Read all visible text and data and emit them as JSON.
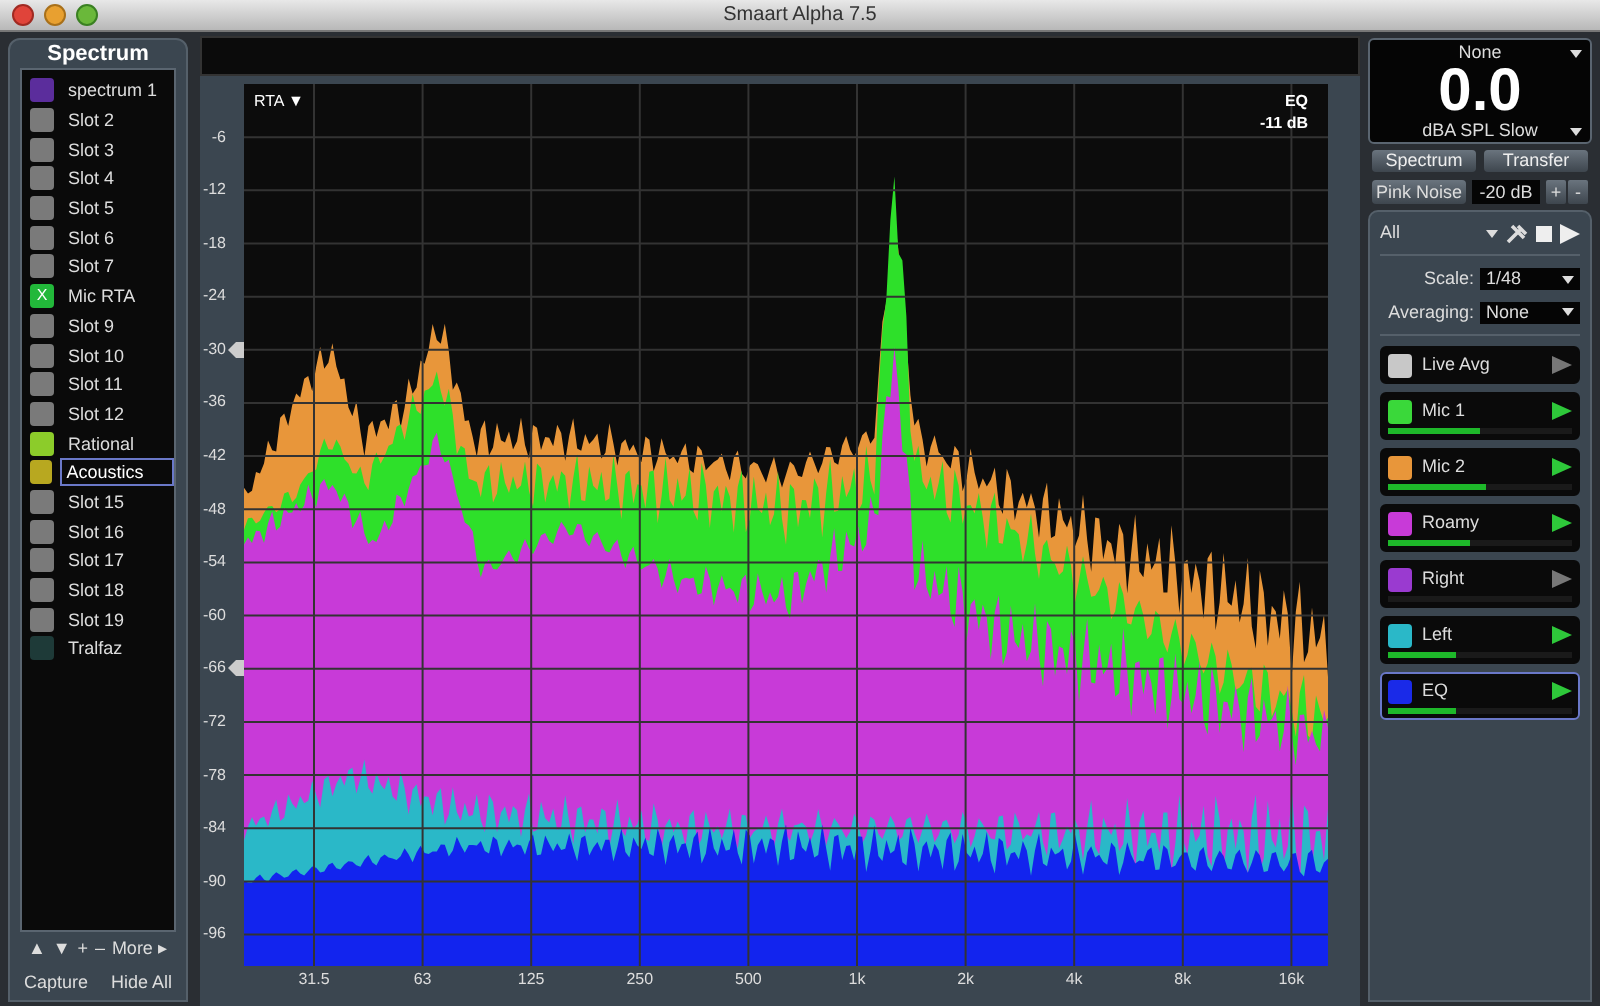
{
  "window": {
    "title": "Smaart Alpha 7.5"
  },
  "sidebar": {
    "title": "Spectrum",
    "slots": [
      {
        "name": "spectrum 1",
        "color": "#5b2d9c",
        "selected": false
      },
      {
        "name": "Slot 2",
        "color": "#7a7a7a",
        "selected": false
      },
      {
        "name": "Slot 3",
        "color": "#7a7a7a",
        "selected": false
      },
      {
        "name": "Slot 4",
        "color": "#7a7a7a",
        "selected": false
      },
      {
        "name": "Slot 5",
        "color": "#7a7a7a",
        "selected": false
      },
      {
        "name": "Slot 6",
        "color": "#7a7a7a",
        "selected": false
      },
      {
        "name": "Slot 7",
        "color": "#7a7a7a",
        "selected": false
      },
      {
        "name": "Mic RTA",
        "color": "#22b83a",
        "symbol": "X",
        "selected": false
      },
      {
        "name": "Slot 9",
        "color": "#7a7a7a",
        "selected": false
      },
      {
        "name": "Slot 10",
        "color": "#7a7a7a",
        "selected": false
      },
      {
        "name": "Slot 11",
        "color": "#7a7a7a",
        "selected": false
      },
      {
        "name": "Slot 12",
        "color": "#7a7a7a",
        "selected": false
      },
      {
        "name": "Rational",
        "color": "#8ccc2a",
        "selected": false
      },
      {
        "name": "Acoustics",
        "color": "#b8a820",
        "selected": true
      },
      {
        "name": "Slot 15",
        "color": "#7a7a7a",
        "selected": false
      },
      {
        "name": "Slot 16",
        "color": "#7a7a7a",
        "selected": false
      },
      {
        "name": "Slot 17",
        "color": "#7a7a7a",
        "selected": false
      },
      {
        "name": "Slot 18",
        "color": "#7a7a7a",
        "selected": false
      },
      {
        "name": "Slot 19",
        "color": "#7a7a7a",
        "selected": false
      },
      {
        "name": "Tralfaz",
        "color": "#1e3a38",
        "selected": false
      }
    ],
    "controls": [
      "▲",
      "▼",
      "+",
      "–",
      "More ▸"
    ],
    "buttons": [
      "Capture",
      "Hide All"
    ]
  },
  "chart": {
    "mode": "RTA ▼",
    "trace": "EQ",
    "trace_level": "-11 dB",
    "y_labels": [
      "-6",
      "-12",
      "-18",
      "-24",
      "-30",
      "-36",
      "-42",
      "-48",
      "-54",
      "-60",
      "-66",
      "-72",
      "-78",
      "-84",
      "-90",
      "-96"
    ],
    "x_labels": [
      "31.5",
      "63",
      "125",
      "250",
      "500",
      "1k",
      "2k",
      "4k",
      "8k",
      "16k"
    ]
  },
  "meter": {
    "source": "None",
    "value": "0.0",
    "unit": "dBA SPL Slow"
  },
  "mode_buttons": [
    "Spectrum",
    "Transfer"
  ],
  "generator": {
    "label": "Pink Noise",
    "gain": "-20 dB",
    "buttons": [
      "+",
      "-"
    ]
  },
  "group": {
    "label": "All",
    "scale_label": "Scale:",
    "scale": "1/48",
    "averaging_label": "Averaging:",
    "averaging": "None"
  },
  "measurements": [
    {
      "name": "Live Avg",
      "color": "#c8c8c8",
      "active": false,
      "selected": false
    },
    {
      "name": "Mic 1",
      "color": "#3ad83a",
      "active": true,
      "level": 0.5,
      "selected": false
    },
    {
      "name": "Mic 2",
      "color": "#e8963a",
      "active": true,
      "level": 0.53,
      "selected": false
    },
    {
      "name": "Roamy",
      "color": "#c83ad8",
      "active": true,
      "level": 0.45,
      "selected": false
    },
    {
      "name": "Right",
      "color": "#9a3ad0",
      "active": false,
      "level": 0,
      "selected": false
    },
    {
      "name": "Left",
      "color": "#2ab8c8",
      "active": true,
      "level": 0.37,
      "selected": false
    },
    {
      "name": "EQ",
      "color": "#1a2ae8",
      "active": true,
      "level": 0.37,
      "selected": true
    }
  ]
}
